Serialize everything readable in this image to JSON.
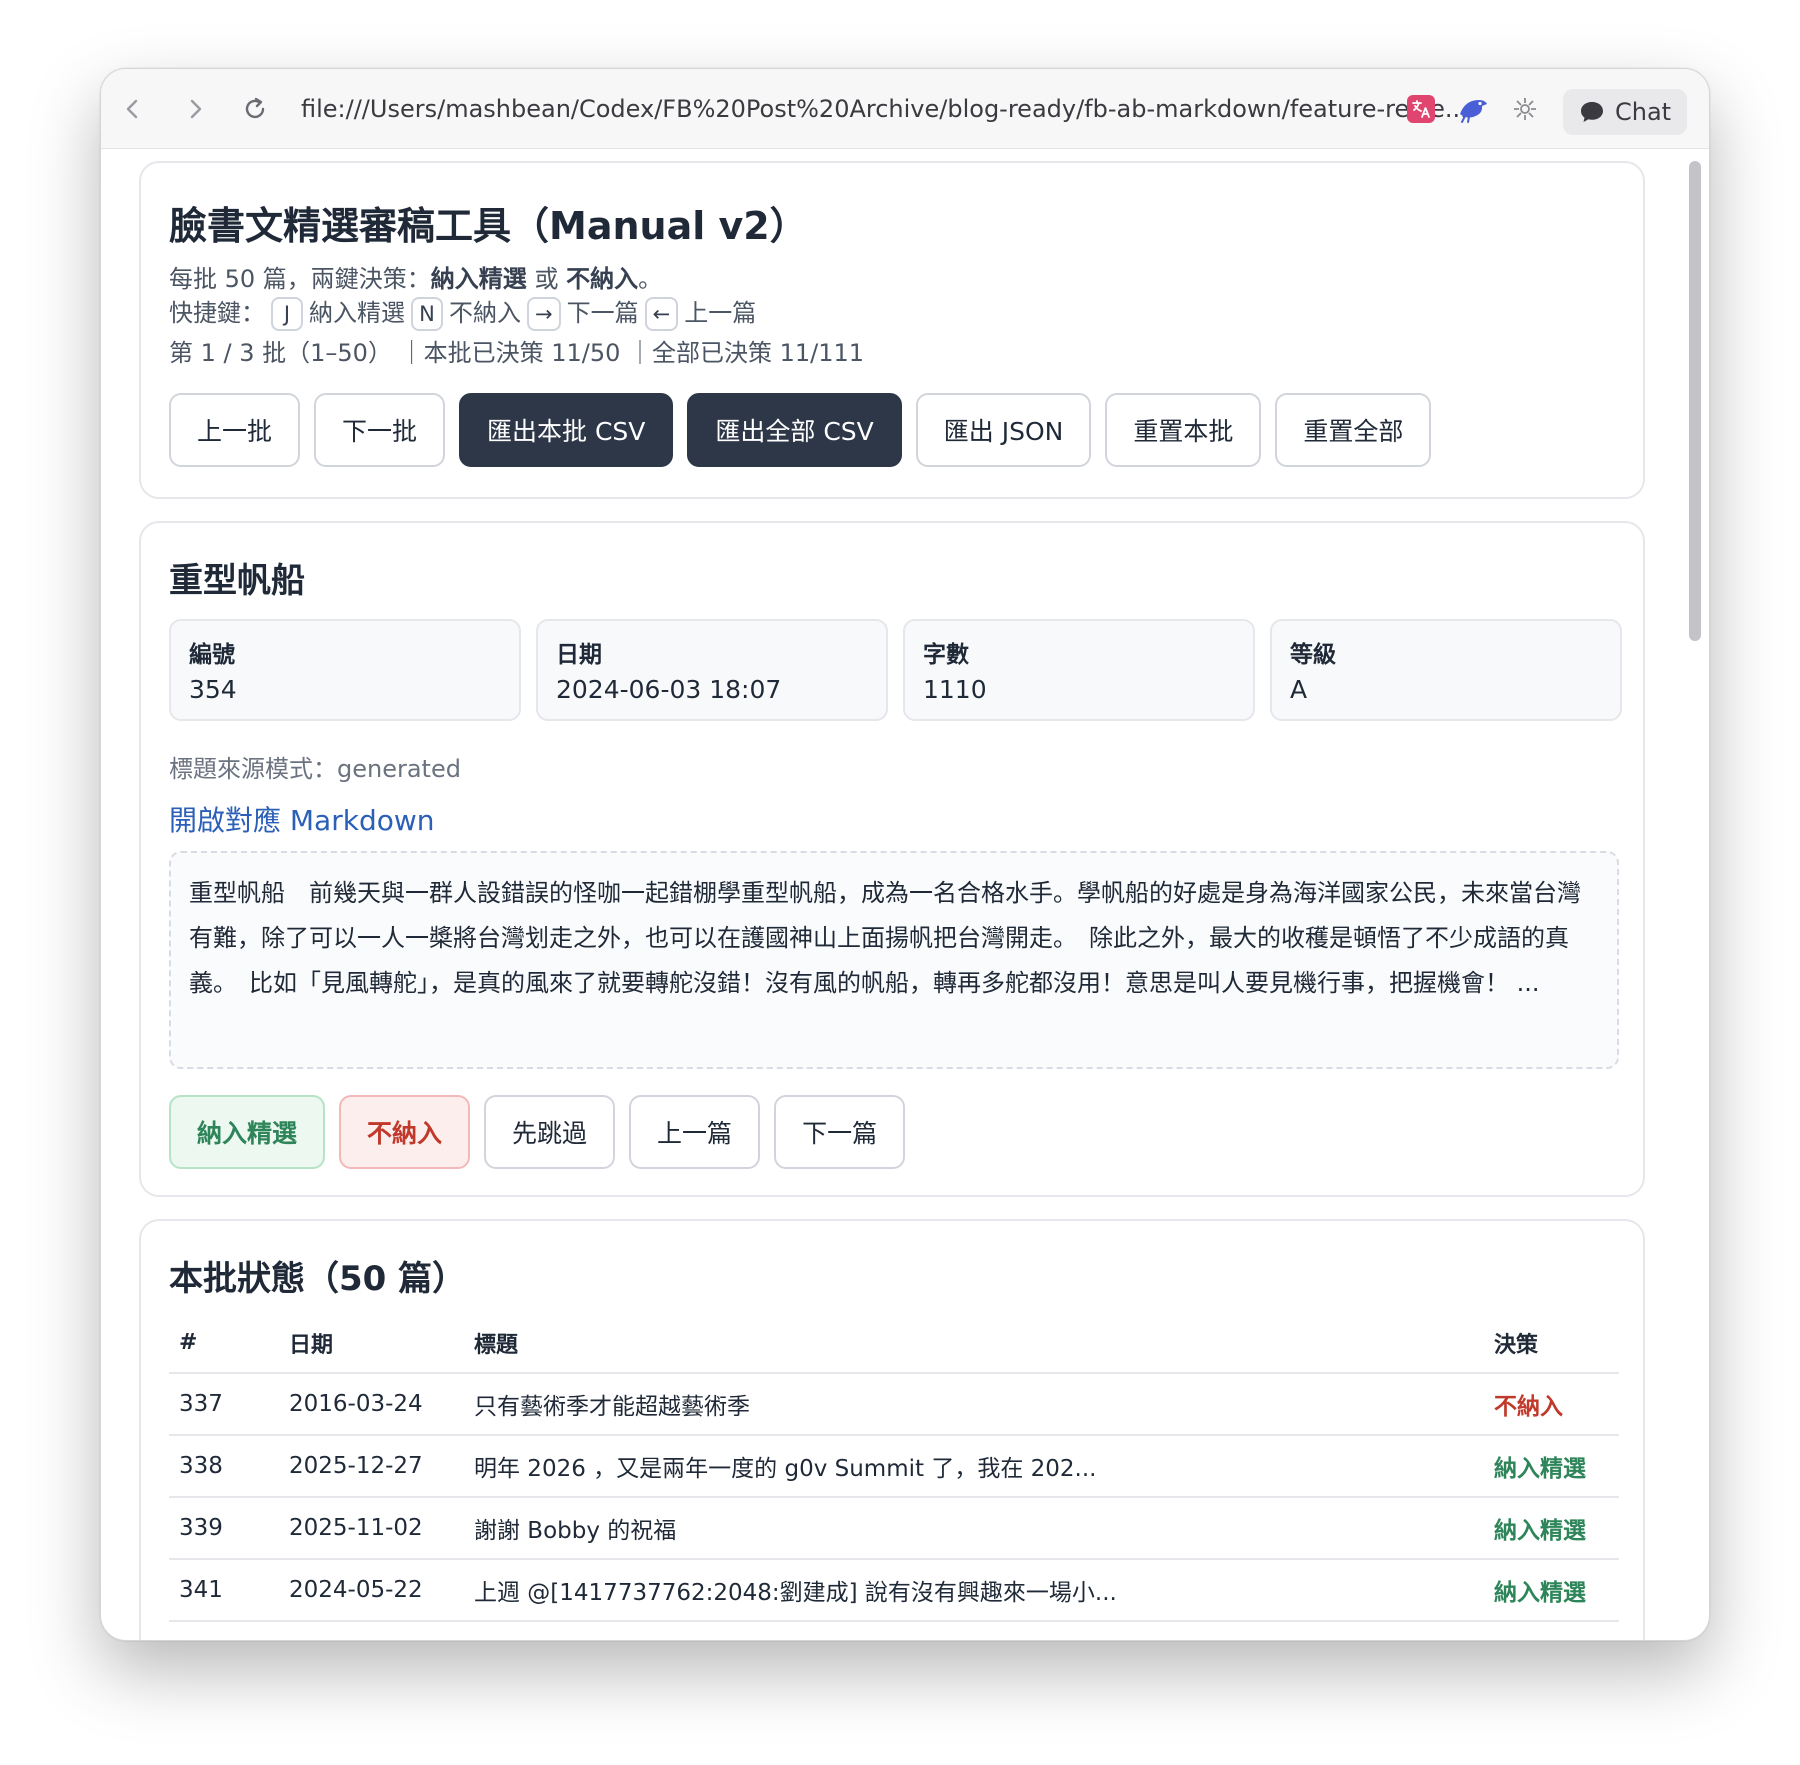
{
  "browser": {
    "url": "file:///Users/mashbean/Codex/FB%20Post%20Archive/blog-ready/fb-ab-markdown/feature-revie...",
    "chat_label": "Chat"
  },
  "header": {
    "title": "臉書文精選審稿工具（Manual v2）",
    "desc_prefix": "每批 50 篇，兩鍵決策：",
    "desc_include": "納入精選",
    "desc_or": "或",
    "desc_exclude": "不納入",
    "desc_suffix": "。",
    "shortcut_label": "快捷鍵：",
    "shortcuts": [
      {
        "key": "J",
        "label": "納入精選"
      },
      {
        "key": "N",
        "label": "不納入"
      },
      {
        "key": "→",
        "label": "下一篇"
      },
      {
        "key": "←",
        "label": "上一篇"
      }
    ],
    "progress": "第 1 / 3 批（1–50） ｜本批已決策 11/50 ｜全部已決策 11/111",
    "buttons": {
      "prev_batch": "上一批",
      "next_batch": "下一批",
      "export_batch_csv": "匯出本批 CSV",
      "export_all_csv": "匯出全部 CSV",
      "export_json": "匯出 JSON",
      "reset_batch": "重置本批",
      "reset_all": "重置全部"
    }
  },
  "post": {
    "title": "重型帆船",
    "meta": [
      {
        "label": "編號",
        "value": "354"
      },
      {
        "label": "日期",
        "value": "2024-06-03 18:07"
      },
      {
        "label": "字數",
        "value": "1110"
      },
      {
        "label": "等級",
        "value": "A"
      }
    ],
    "title_source": "標題來源模式：generated",
    "markdown_link": "開啟對應 Markdown",
    "excerpt": "重型帆船　前幾天與一群人設錯誤的怪咖一起錯棚學重型帆船，成為一名合格水手。學帆船的好處是身為海洋國家公民，未來當台灣有難，除了可以一人一槳將台灣划走之外，也可以在護國神山上面揚帆把台灣開走。　除此之外，最大的收穫是頓悟了不少成語的真義。　比如「見風轉舵」，是真的風來了就要轉舵沒錯！沒有風的帆船，轉再多舵都沒用！意思是叫人要見機行事，把握機會！ ...",
    "actions": {
      "include": "納入精選",
      "exclude": "不納入",
      "skip": "先跳過",
      "prev": "上一篇",
      "next": "下一篇"
    }
  },
  "batch": {
    "title": "本批狀態（50 篇）",
    "columns": [
      "#",
      "日期",
      "標題",
      "決策"
    ],
    "rows": [
      {
        "num": "337",
        "date": "2016-03-24",
        "title": "只有藝術季才能超越藝術季",
        "decision": "不納入"
      },
      {
        "num": "338",
        "date": "2025-12-27",
        "title": "明年 2026 ，又是兩年一度的 g0v Summit 了，我在 202...",
        "decision": "納入精選"
      },
      {
        "num": "339",
        "date": "2025-11-02",
        "title": "謝謝 Bobby 的祝福",
        "decision": "納入精選"
      },
      {
        "num": "341",
        "date": "2024-05-22",
        "title": "上週 @[1417737762:2048:劉建成] 說有沒有興趣來一場小...",
        "decision": "納入精選"
      }
    ]
  },
  "colors": {
    "include": "#2f855a",
    "exclude": "#c0392b",
    "dark_button": "#2d3748",
    "link": "#2b5fb8"
  }
}
